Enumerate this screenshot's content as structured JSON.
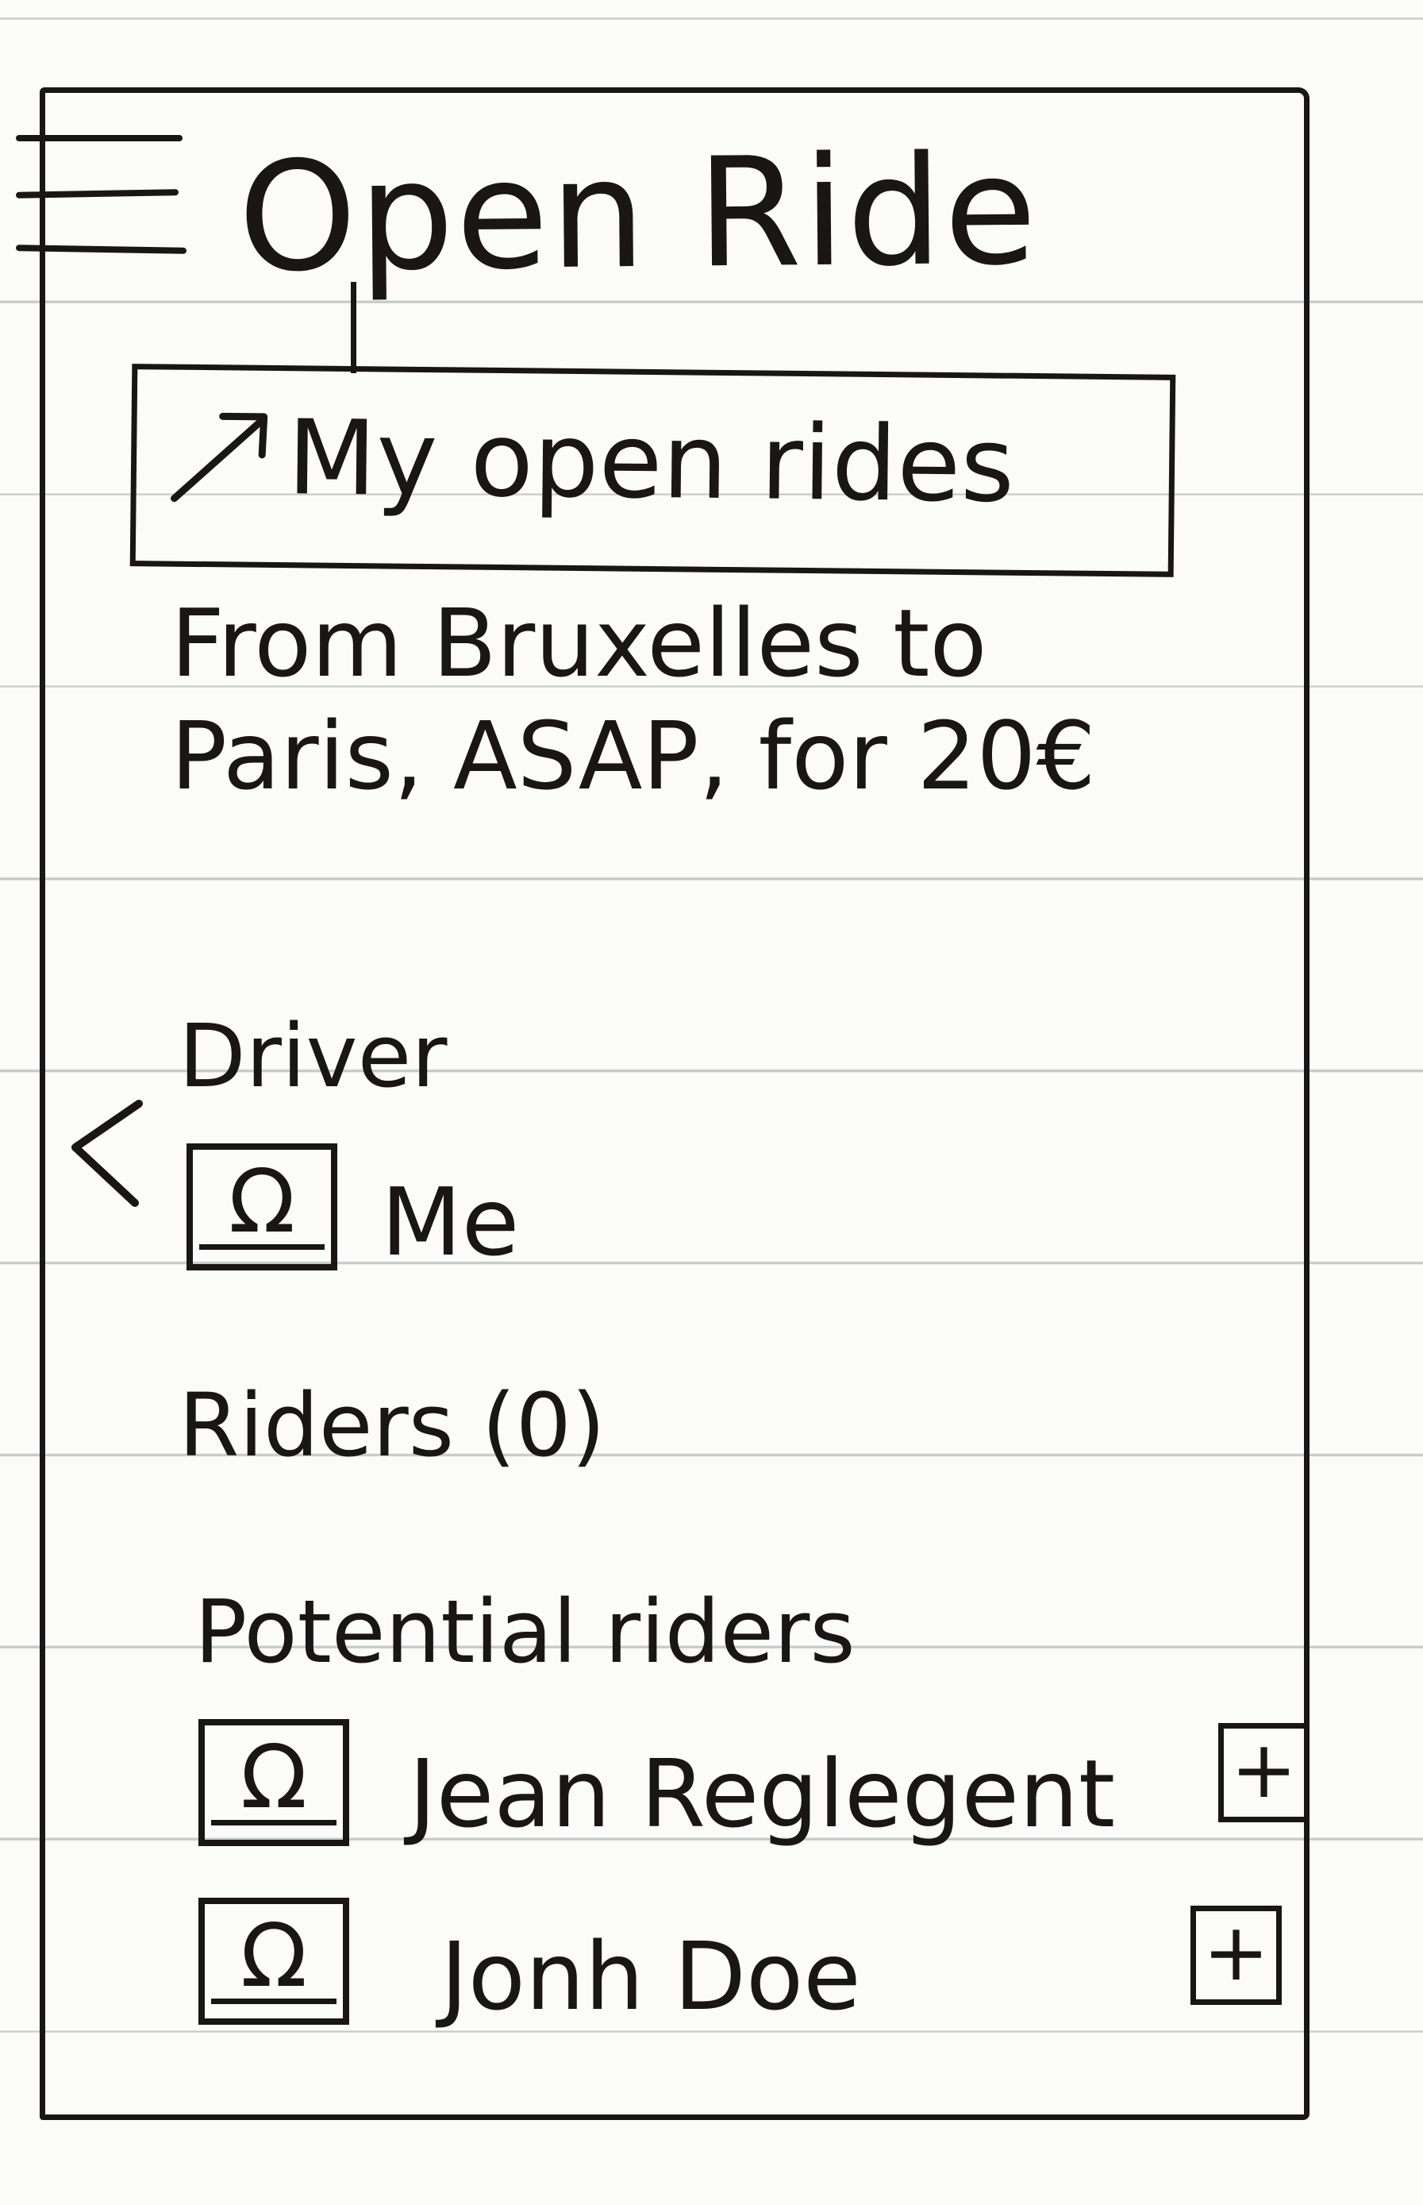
{
  "header": {
    "menu_icon": "hamburger-menu-icon",
    "title": "Open Ride"
  },
  "dropdown": {
    "icon": "diagonal-arrow-icon",
    "label": "My open rides"
  },
  "ride": {
    "summary": "From Bruxelles to Paris, ASAP, for 20€"
  },
  "navigation": {
    "back_icon": "chevron-left-icon"
  },
  "driver": {
    "heading": "Driver",
    "avatar_icon": "omega-avatar-icon",
    "avatar_glyph": "Ω",
    "name": "Me"
  },
  "riders": {
    "heading": "Riders (0)"
  },
  "potential_riders": {
    "heading": "Potential riders",
    "items": [
      {
        "name": "Jean Reglegent",
        "avatar_glyph": "Ω",
        "add_symbol": "+"
      },
      {
        "name": "Jonh Doe",
        "avatar_glyph": "Ω",
        "add_symbol": "+"
      }
    ]
  },
  "colors": {
    "ink": "#1a1614",
    "paper": "#fbfbf8",
    "ruling": "#9aa0a6"
  }
}
